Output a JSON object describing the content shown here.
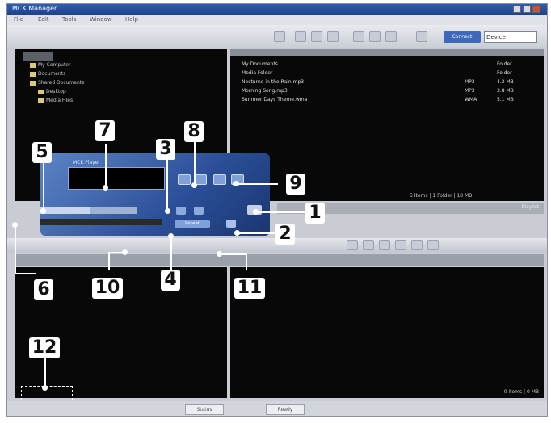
{
  "window": {
    "title": "MCK Manager 1"
  },
  "menu": [
    "File",
    "Edit",
    "Tools",
    "Window",
    "Help"
  ],
  "toolbar": {
    "device_button": "Connect",
    "device_select": "Device"
  },
  "tree": {
    "items": [
      "My Computer",
      "Documents",
      "Shared Documents",
      "Desktop",
      "Media Files"
    ]
  },
  "file_list": {
    "rows": [
      {
        "name": "My Documents",
        "type": "",
        "size": "Folder"
      },
      {
        "name": "Media Folder",
        "type": "",
        "size": "Folder"
      },
      {
        "name": "Nocturne in the Rain.mp3",
        "type": "MP3",
        "size": "4.2 MB"
      },
      {
        "name": "Morning Song.mp3",
        "type": "MP3",
        "size": "3.8 MB"
      },
      {
        "name": "Summer Days Theme.wma",
        "type": "WMA",
        "size": "5.1 MB"
      }
    ],
    "status": "5 Items | 1 Folder | 18 MB"
  },
  "player": {
    "title_label": "MCK Player",
    "repeat_label": "Repeat"
  },
  "device_panel": {
    "label": "Playlist",
    "status": "0 items | 0 MB"
  },
  "bottom": {
    "left_field": "Status",
    "right_field": "Ready"
  },
  "callouts": [
    "1",
    "2",
    "3",
    "4",
    "5",
    "6",
    "7",
    "8",
    "9",
    "10",
    "11",
    "12"
  ],
  "colors": {
    "accent": "#3f67bc",
    "pane_bg": "#080808",
    "player": "#2b4f98"
  }
}
